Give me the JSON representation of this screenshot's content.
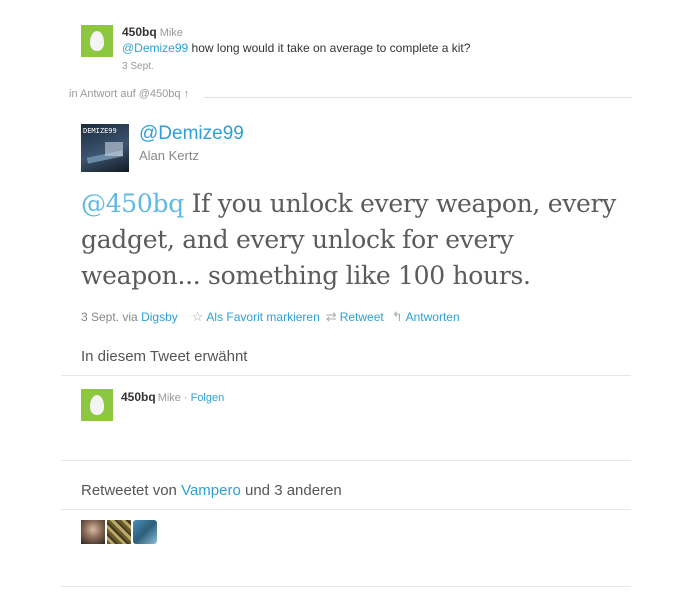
{
  "parent_tweet": {
    "screen_name": "450bq",
    "full_name": "Mike",
    "mention": "@Demize99",
    "text": " how long would it take on average to complete a kit?",
    "time": "3 Sept."
  },
  "reply_context": "in Antwort auf @450bq ↑",
  "main_tweet": {
    "screen_name": "@Demize99",
    "full_name": "Alan Kertz",
    "avatar_text": "DEMIZE99",
    "mention": "@450bq",
    "text": " If you unlock every weapon, every gadget, and every unlock for every weapon... something like 100 hours.",
    "time": "3 Sept.",
    "via_label": "via",
    "via_client": "Digsby",
    "actions": {
      "favorite": "Als Favorit markieren",
      "retweet": "Retweet",
      "reply": "Antworten"
    }
  },
  "mentioned_section": {
    "heading": "In diesem Tweet erwähnt",
    "user": {
      "screen_name": "450bq",
      "full_name": "Mike",
      "separator": "·",
      "follow_label": "Folgen"
    }
  },
  "retweet_section": {
    "prefix": "Retweetet von ",
    "user": "Vampero",
    "suffix": " und 3 anderen"
  },
  "colors": {
    "link": "#2fa0d6",
    "egg_avatar": "#8dc63f",
    "tweet_text": "#5b5b5b"
  },
  "icons": [
    "star-icon",
    "retweet-icon",
    "reply-icon",
    "egg-avatar"
  ]
}
